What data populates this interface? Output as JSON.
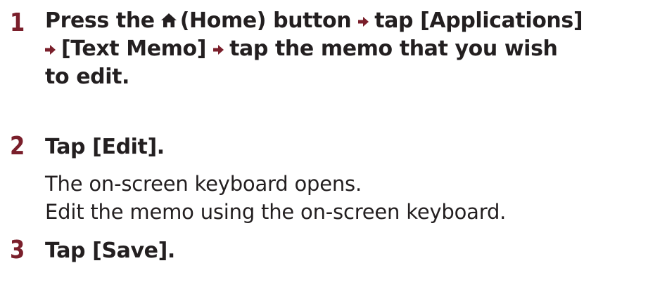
{
  "steps": [
    {
      "number": "1",
      "heading": {
        "part1": "Press the",
        "home_label": "(Home) button",
        "part2": "tap [Applications]",
        "part3": "[Text Memo]",
        "part4": "tap the memo that you wish",
        "part5": "to edit."
      }
    },
    {
      "number": "2",
      "heading": "Tap [Edit].",
      "body": [
        "The on-screen keyboard opens.",
        "Edit the memo using the on-screen keyboard."
      ]
    },
    {
      "number": "3",
      "heading": "Tap [Save]."
    }
  ],
  "colors": {
    "step_number": "#7a1f2b",
    "arrow": "#7a1f2b",
    "text": "#231f20"
  },
  "icons": {
    "home": "home-icon",
    "arrow": "arrow-right-icon"
  }
}
